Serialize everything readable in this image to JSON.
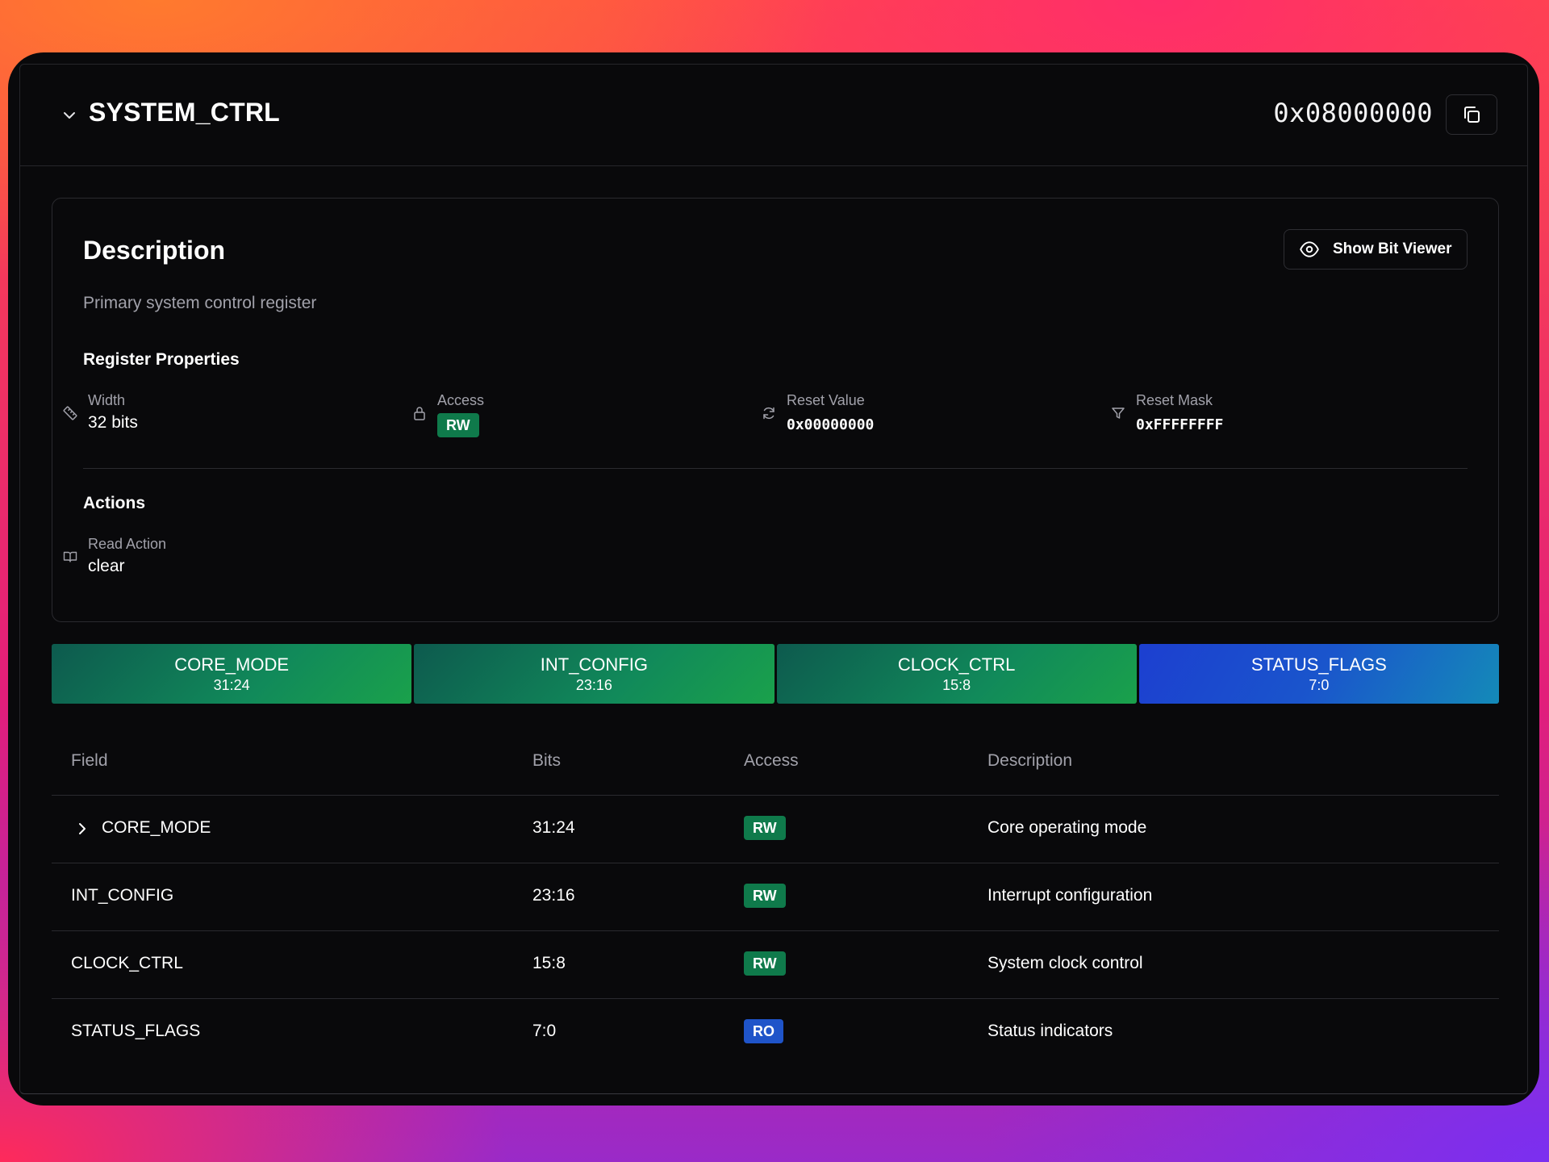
{
  "header": {
    "register_name": "SYSTEM_CTRL",
    "address": "0x08000000"
  },
  "description_card": {
    "title": "Description",
    "bit_viewer_label": "Show Bit Viewer",
    "text": "Primary system control register",
    "properties_title": "Register Properties",
    "properties": [
      {
        "label": "Width",
        "value": "32 bits",
        "icon": "ruler-icon"
      },
      {
        "label": "Access",
        "value": "RW",
        "icon": "lock-icon"
      },
      {
        "label": "Reset Value",
        "value": "0x00000000",
        "icon": "refresh-icon"
      },
      {
        "label": "Reset Mask",
        "value": "0xFFFFFFFF",
        "icon": "filter-icon"
      }
    ],
    "actions_title": "Actions",
    "actions": [
      {
        "label": "Read Action",
        "value": "clear",
        "icon": "book-open-icon"
      }
    ]
  },
  "bit_map": [
    {
      "name": "CORE_MODE",
      "bits": "31:24",
      "access": "RW"
    },
    {
      "name": "INT_CONFIG",
      "bits": "23:16",
      "access": "RW"
    },
    {
      "name": "CLOCK_CTRL",
      "bits": "15:8",
      "access": "RW"
    },
    {
      "name": "STATUS_FLAGS",
      "bits": "7:0",
      "access": "RO"
    }
  ],
  "fields_table": {
    "columns": [
      "Field",
      "Bits",
      "Access",
      "Description"
    ],
    "rows": [
      {
        "field": "CORE_MODE",
        "bits": "31:24",
        "access": "RW",
        "description": "Core operating mode",
        "expandable": true
      },
      {
        "field": "INT_CONFIG",
        "bits": "23:16",
        "access": "RW",
        "description": "Interrupt configuration"
      },
      {
        "field": "CLOCK_CTRL",
        "bits": "15:8",
        "access": "RW",
        "description": "System clock control"
      },
      {
        "field": "STATUS_FLAGS",
        "bits": "7:0",
        "access": "RO",
        "description": "Status indicators"
      }
    ]
  },
  "colors": {
    "rw_badge": "#0f7a4b",
    "ro_badge": "#1f54c9",
    "panel_bg": "#09090b"
  }
}
